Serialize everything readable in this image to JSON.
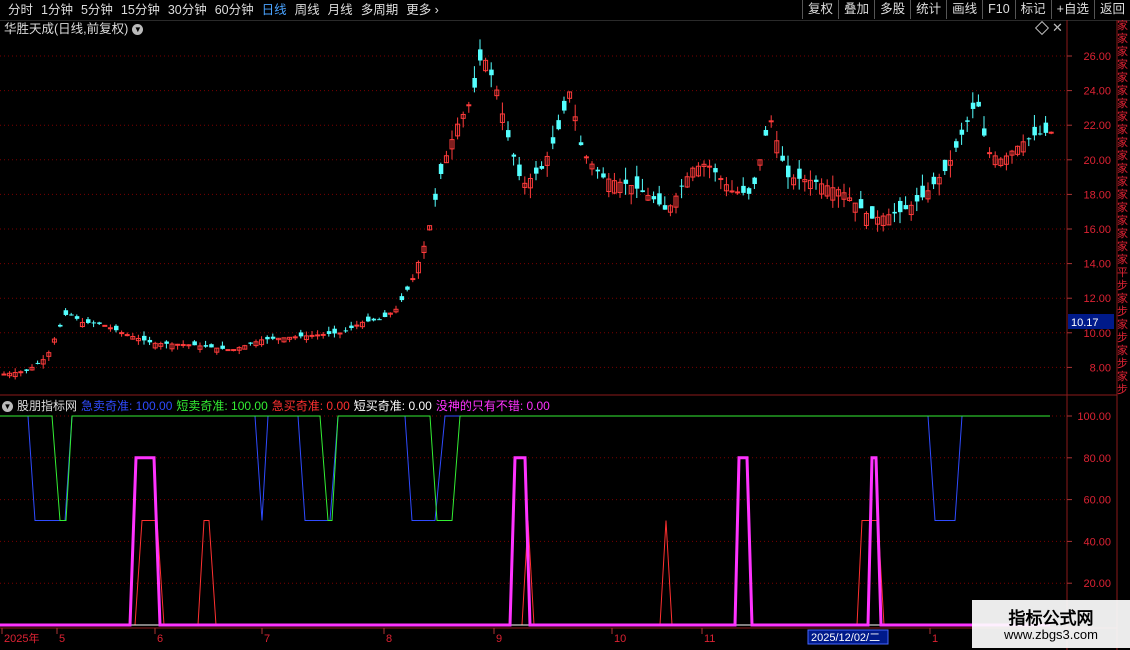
{
  "menu": {
    "left": [
      {
        "label": "分时",
        "active": false
      },
      {
        "label": "1分钟",
        "active": false
      },
      {
        "label": "5分钟",
        "active": false
      },
      {
        "label": "15分钟",
        "active": false
      },
      {
        "label": "30分钟",
        "active": false
      },
      {
        "label": "60分钟",
        "active": false
      },
      {
        "label": "日线",
        "active": true
      },
      {
        "label": "周线",
        "active": false
      },
      {
        "label": "月线",
        "active": false
      },
      {
        "label": "多周期",
        "active": false
      },
      {
        "label": "更多 ›",
        "active": false
      }
    ],
    "right": [
      "复权",
      "叠加",
      "多股",
      "统计",
      "画线",
      "F10",
      "标记",
      "+自选",
      "返回"
    ]
  },
  "main_chart": {
    "title": "华胜天成(日线,前复权)",
    "price_axis": [
      "26.00",
      "24.00",
      "22.00",
      "20.00",
      "18.00",
      "16.00",
      "14.00",
      "12.00",
      "10.00",
      "8.00"
    ],
    "current_price": "10.17",
    "colors": {
      "up": "#ff3b3b",
      "down": "#54ffff",
      "grid": "#8b0000"
    }
  },
  "indicator": {
    "name": "股朋指标网",
    "items": [
      {
        "label": "急卖奇准: 100.00",
        "color": "#2f4bff"
      },
      {
        "label": "短卖奇准: 100.00",
        "color": "#33ee33"
      },
      {
        "label": "急买奇准: 0.00",
        "color": "#ff3030"
      },
      {
        "label": "短买奇准: 0.00",
        "color": "#ffffff"
      },
      {
        "label": "没神的只有不错: 0.00",
        "color": "#ff33ff"
      }
    ],
    "axis": [
      "100.00",
      "80.00",
      "60.00",
      "40.00",
      "20.00"
    ]
  },
  "chart_data": {
    "type": "line",
    "title": "股朋指标网",
    "series": [
      {
        "name": "急卖奇准",
        "color": "#2f4bff"
      },
      {
        "name": "短卖奇准",
        "color": "#33ee33"
      },
      {
        "name": "急买奇准",
        "color": "#ff3030"
      },
      {
        "name": "短买奇准",
        "color": "#ffffff"
      },
      {
        "name": "没神的只有不错",
        "color": "#ff33ff"
      }
    ],
    "ylim": [
      0,
      100
    ]
  },
  "date_axis": {
    "labels": [
      "2025年",
      "5",
      "6",
      "7",
      "8",
      "9",
      "10",
      "11",
      "1"
    ],
    "cursor_date": "2025/12/02/二"
  },
  "sidebar": "家家家家家家家家家家家家家家家家家家家平步家步家步家步家步",
  "watermark": {
    "title": "指标公式网",
    "url": "www.zbgs3.com"
  }
}
